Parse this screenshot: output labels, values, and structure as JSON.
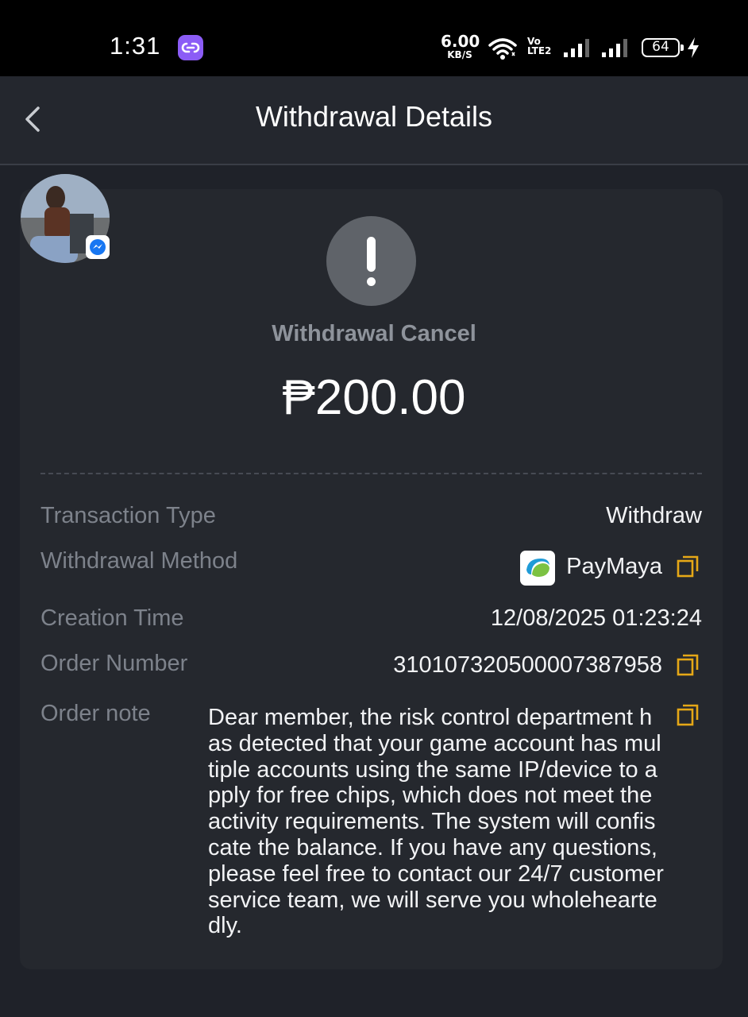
{
  "status_bar": {
    "time": "1:31",
    "net_speed_value": "6.00",
    "net_speed_unit": "KB/S",
    "volte_top": "Vo",
    "volte_bottom": "LTE2",
    "battery": "64"
  },
  "header": {
    "title": "Withdrawal Details"
  },
  "status": {
    "text": "Withdrawal Cancel",
    "amount": "₱200.00",
    "icon_color": "#5f6369"
  },
  "details": {
    "transaction_type_label": "Transaction Type",
    "transaction_type_value": "Withdraw",
    "withdrawal_method_label": "Withdrawal Method",
    "withdrawal_method_value": "PayMaya",
    "creation_time_label": "Creation Time",
    "creation_time_value": "12/08/2025 01:23:24",
    "order_number_label": "Order Number",
    "order_number_value": "3101073205000073879​58",
    "order_note_label": "Order note",
    "order_note_value": "Dear member, the risk control department has detected that your game account has multiple accounts using the same IP/device to apply for free chips, which does not meet the activity requirements. The system will confiscate the balance. If you have any questions, please feel free to contact our 24/7 customer service team, we will serve you wholeheartedly."
  },
  "colors": {
    "background": "#1f2229",
    "card": "#25282e",
    "accent_copy": "#e6a817",
    "label": "#7d828b"
  }
}
